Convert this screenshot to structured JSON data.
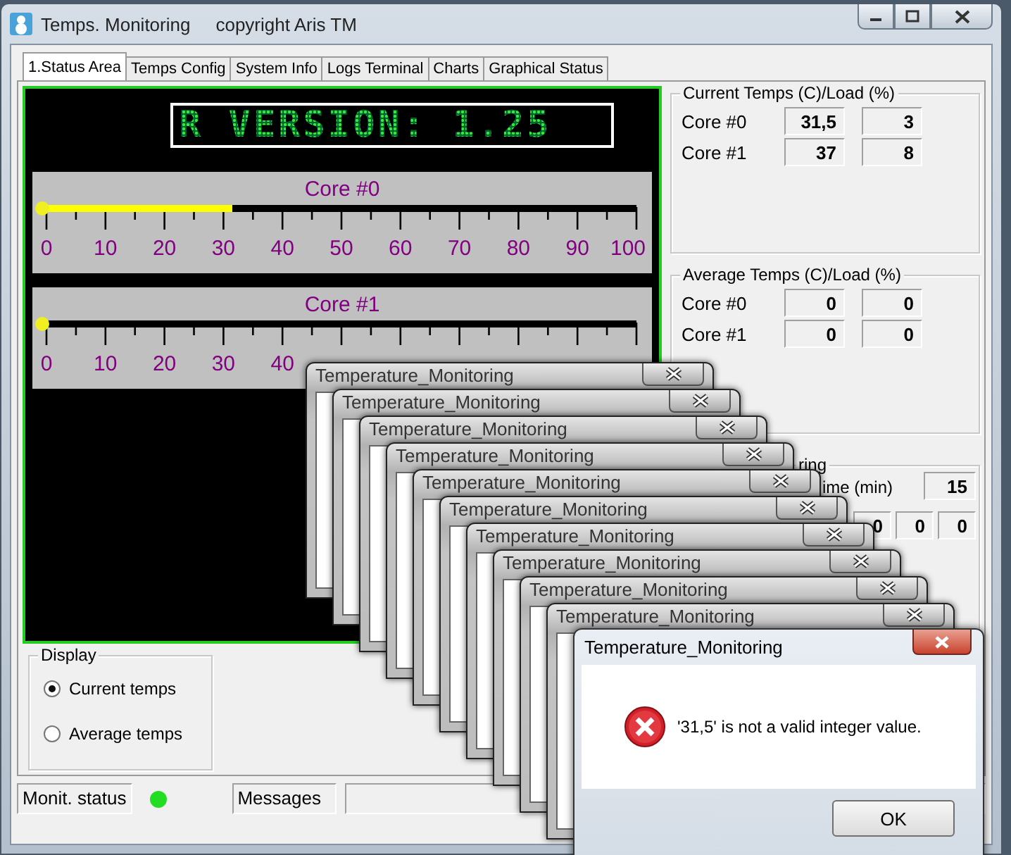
{
  "window": {
    "title": "Temps. Monitoring",
    "subtitle": "copyright Aris TM"
  },
  "tabs": [
    {
      "label": "1.Status Area",
      "selected": true
    },
    {
      "label": "Temps Config",
      "selected": false
    },
    {
      "label": "System Info",
      "selected": false
    },
    {
      "label": "Logs Terminal",
      "selected": false
    },
    {
      "label": "Charts",
      "selected": false
    },
    {
      "label": "Graphical Status",
      "selected": false
    }
  ],
  "led_display": {
    "text": "R VERSION: 1.25"
  },
  "gauges": [
    {
      "title": "Core #0",
      "level": 0.315,
      "scale_labels": [
        "0",
        "10",
        "20",
        "30",
        "40",
        "50",
        "60",
        "70",
        "80",
        "90",
        "100"
      ]
    },
    {
      "title": "Core #1",
      "level": 0,
      "scale_labels": [
        "0",
        "10",
        "20",
        "30",
        "40"
      ]
    }
  ],
  "current_group": {
    "title": "Current Temps (C)/Load (%)",
    "rows": [
      {
        "label": "Core #0",
        "temp": "31,5",
        "load": "3"
      },
      {
        "label": "Core #1",
        "temp": "37",
        "load": "8"
      }
    ]
  },
  "average_group": {
    "title": "Average Temps (C)/Load (%)",
    "rows": [
      {
        "label": "Core #0",
        "temp": "0",
        "load": "0"
      },
      {
        "label": "Core #1",
        "temp": "0",
        "load": "0"
      }
    ]
  },
  "partial_group": {
    "title": "ring",
    "time_label": "ime (min)",
    "time_value": "15",
    "values": [
      "0",
      "0",
      "0"
    ]
  },
  "display_group": {
    "title": "Display",
    "options": [
      {
        "label": "Current temps",
        "selected": true
      },
      {
        "label": "Average temps",
        "selected": false
      }
    ]
  },
  "status_bar": {
    "status_label": "Monit. status",
    "status_on": true,
    "messages_label": "Messages"
  },
  "stacked_dialogs": [
    {
      "title": "Temperature_Monitoring"
    },
    {
      "title": "Temperature_Monitoring"
    },
    {
      "title": "Temperature_Monitoring"
    },
    {
      "title": "Temperature_Monitoring"
    },
    {
      "title": "Temperature_Monitoring"
    },
    {
      "title": "Temperature_Monitoring"
    },
    {
      "title": "Temperature_Monitoring"
    },
    {
      "title": "Temperature_Monitoring"
    },
    {
      "title": "Temperature_Monitoring"
    },
    {
      "title": "Temperature_Monitoring"
    }
  ],
  "error_dialog": {
    "title": "Temperature_Monitoring",
    "message": "'31,5' is not a valid integer value.",
    "button": "OK"
  }
}
